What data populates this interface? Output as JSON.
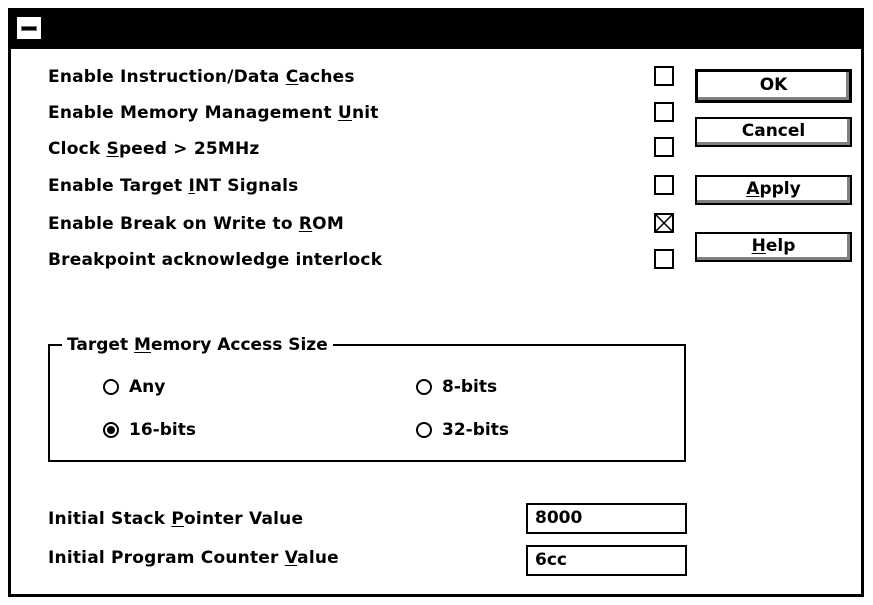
{
  "checkboxes": [
    {
      "pre": "Enable Instruction/Data ",
      "key": "C",
      "post": "aches",
      "checked": false
    },
    {
      "pre": "Enable Memory Management ",
      "key": "U",
      "post": "nit",
      "checked": false
    },
    {
      "pre": "Clock ",
      "key": "S",
      "post": "peed > 25MHz",
      "checked": false
    },
    {
      "pre": "Enable Target ",
      "key": "I",
      "post": "NT Signals",
      "checked": false
    },
    {
      "pre": "Enable Break on Write to ",
      "key": "R",
      "post": "OM",
      "checked": true
    },
    {
      "pre": "Breakpoint acknowledge interlock",
      "key": "",
      "post": "",
      "checked": false
    }
  ],
  "buttons": {
    "ok": {
      "pre": "OK",
      "key": "",
      "post": ""
    },
    "cancel": {
      "pre": "Cancel",
      "key": "",
      "post": ""
    },
    "apply": {
      "pre": "",
      "key": "A",
      "post": "pply"
    },
    "help": {
      "pre": "",
      "key": "H",
      "post": "elp"
    }
  },
  "memory_group": {
    "title_pre": "Target ",
    "title_key": "M",
    "title_post": "emory Access Size",
    "options": [
      {
        "label": "Any",
        "selected": false
      },
      {
        "label": "8-bits",
        "selected": false
      },
      {
        "label": "16-bits",
        "selected": true
      },
      {
        "label": "32-bits",
        "selected": false
      }
    ]
  },
  "fields": {
    "stack_pointer": {
      "label_pre": "Initial Stack ",
      "label_key": "P",
      "label_post": "ointer Value",
      "value": "8000"
    },
    "program_counter": {
      "label_pre": "Initial Program Counter ",
      "label_key": "V",
      "label_post": "alue",
      "value": "6cc"
    }
  }
}
